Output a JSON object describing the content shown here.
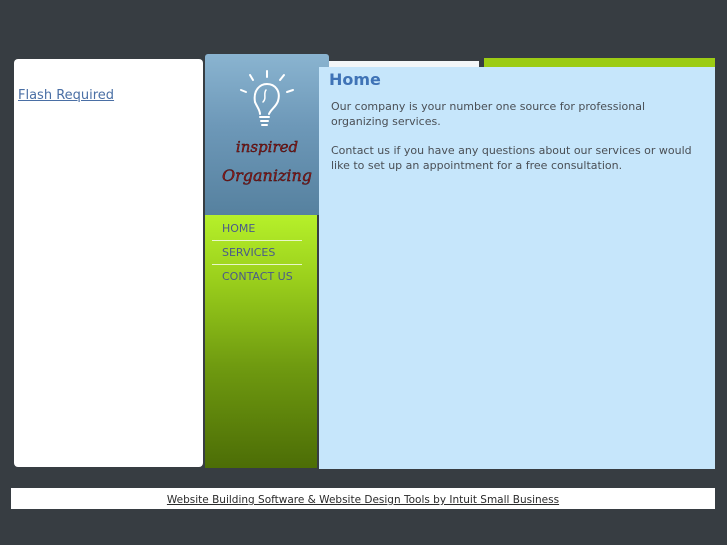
{
  "flash": {
    "link_text": "Flash Required"
  },
  "logo": {
    "line1": "inspired",
    "line2": "Organizing"
  },
  "nav": {
    "items": [
      {
        "label": "HOME"
      },
      {
        "label": "SERVICES"
      },
      {
        "label": "CONTACT US"
      }
    ]
  },
  "main": {
    "title": "Home",
    "paragraphs": [
      "Our company is your number one source for professional organizing services.",
      "Contact us if you have any questions about our services or would like to set up an appointment for a free consultation."
    ]
  },
  "footer": {
    "link_text": "Website Building Software & Website Design Tools by Intuit Small Business"
  },
  "colors": {
    "background": "#373d42",
    "accent_green": "#9ccc14",
    "content_bg": "#c6e6fb",
    "title_blue": "#3f73b6",
    "logo_red": "#8b1a1a"
  },
  "icons": {
    "logo_icon": "lightbulb-icon"
  }
}
